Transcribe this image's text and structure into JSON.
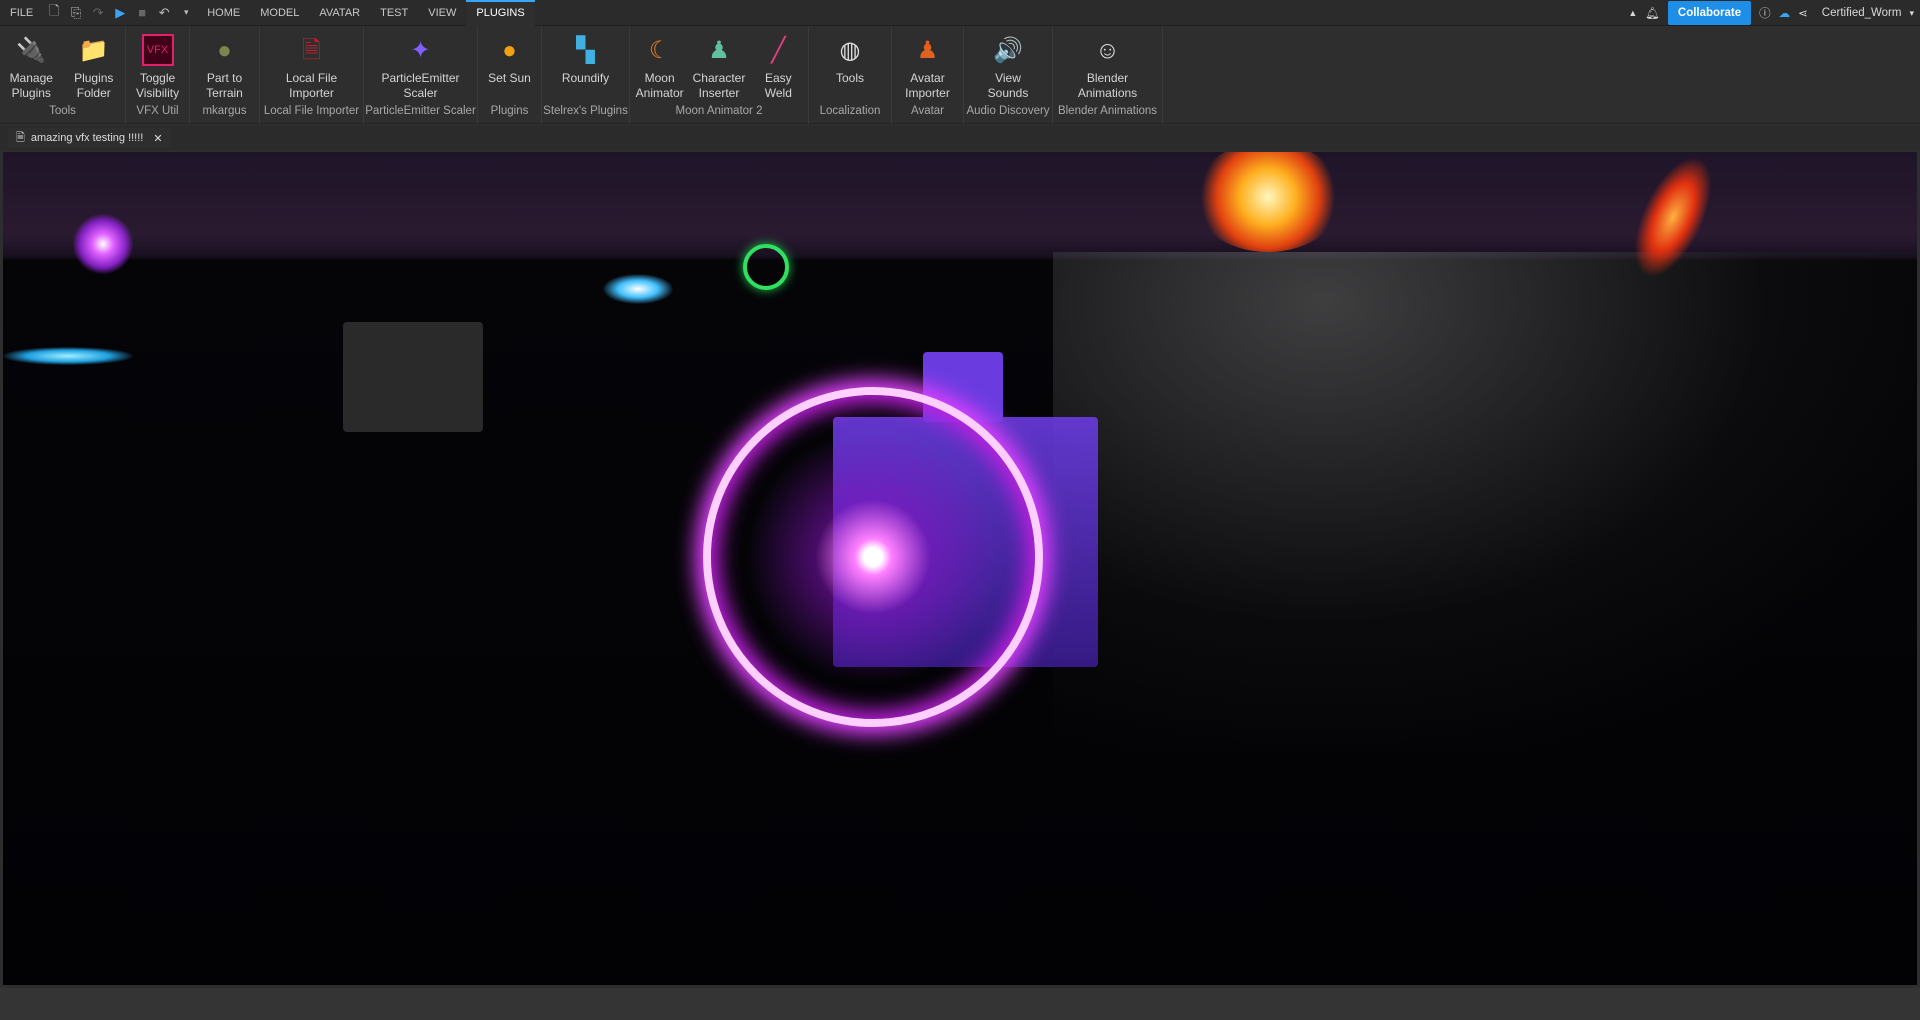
{
  "menubar": {
    "file": "FILE",
    "tabs": [
      "HOME",
      "MODEL",
      "AVATAR",
      "TEST",
      "VIEW",
      "PLUGINS"
    ],
    "active_tab": "PLUGINS",
    "collaborate": "Collaborate",
    "username": "Certified_Worm"
  },
  "ribbon": {
    "groups": [
      {
        "label": "Tools",
        "buttons": [
          "Manage\nPlugins",
          "Plugins\nFolder"
        ]
      },
      {
        "label": "VFX Util",
        "buttons": [
          "Toggle\nVisibility"
        ]
      },
      {
        "label": "mkargus",
        "buttons": [
          "Part to\nTerrain"
        ]
      },
      {
        "label": "Local File Importer",
        "buttons": [
          "Local File\nImporter"
        ]
      },
      {
        "label": "ParticleEmitter Scaler",
        "buttons": [
          "ParticleEmitter\nScaler"
        ]
      },
      {
        "label": "Plugins",
        "buttons": [
          "Set Sun"
        ]
      },
      {
        "label": "Stelrex's Plugins",
        "buttons": [
          "Roundify"
        ]
      },
      {
        "label": "Moon Animator 2",
        "buttons": [
          "Moon\nAnimator",
          "Character\nInserter",
          "Easy\nWeld"
        ]
      },
      {
        "label": "Localization",
        "buttons": [
          "Tools"
        ]
      },
      {
        "label": "Avatar",
        "buttons": [
          "Avatar\nImporter"
        ]
      },
      {
        "label": "Audio Discovery",
        "buttons": [
          "View\nSounds"
        ]
      },
      {
        "label": "Blender Animations",
        "buttons": [
          "Blender\nAnimations"
        ]
      }
    ]
  },
  "icons": {
    "0": [
      "plug-gear-icon",
      "folder-plug-icon"
    ],
    "1": [
      "vfx-icon"
    ],
    "2": [
      "terrain-sphere-icon"
    ],
    "3": [
      "file-import-icon"
    ],
    "4": [
      "particle-scale-icon"
    ],
    "5": [
      "sun-icon"
    ],
    "6": [
      "roundify-icon"
    ],
    "7": [
      "moon-icon",
      "character-icon",
      "weld-icon"
    ],
    "8": [
      "globe-pin-icon"
    ],
    "9": [
      "avatar-import-icon"
    ],
    "10": [
      "speaker-icon"
    ],
    "11": [
      "blender-figure-icon"
    ]
  },
  "document_tab": {
    "title": "amazing vfx testing !!!!!"
  },
  "colors": {
    "accent": "#1f8ee6",
    "vfx_glow": "#e040ff"
  }
}
